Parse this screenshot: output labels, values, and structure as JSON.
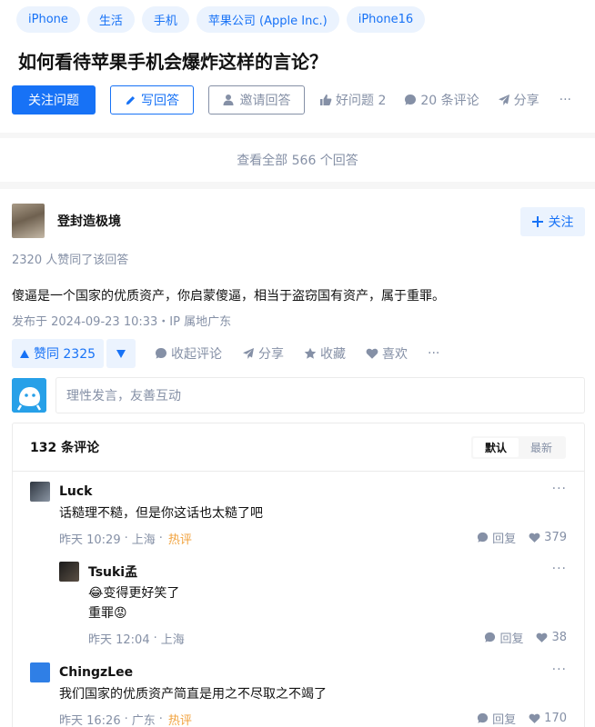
{
  "question": {
    "topics": [
      "iPhone",
      "生活",
      "手机",
      "苹果公司 (Apple Inc.)",
      "iPhone16"
    ],
    "title": "如何看待苹果手机会爆炸这样的言论？",
    "follow_label": "关注问题",
    "write_answer_label": "写回答",
    "invite_label": "邀请回答",
    "good_question_label": "好问题 2",
    "comments_label": "20 条评论",
    "share_label": "分享",
    "more_label": "···"
  },
  "view_all_label": "查看全部 566 个回答",
  "answer": {
    "author_name": "登封造极境",
    "follow_label": "关注",
    "votes_line": "2320 人赞同了该回答",
    "content": "傻逼是一个国家的优质资产，你启蒙傻逼，相当于盗窃国有资产，属于重罪。",
    "publish_info": "发布于 2024-09-23 10:33・IP 属地广东",
    "upvote_label": "赞同 2325",
    "collapse_comments_label": "收起评论",
    "share_label": "分享",
    "collect_label": "收藏",
    "like_label": "喜欢",
    "more_label": "···"
  },
  "reply_box": {
    "placeholder": "理性发言，友善互动"
  },
  "comments": {
    "count_label": "132 条评论",
    "sort_default": "默认",
    "sort_latest": "最新",
    "reply_label": "回复",
    "items": [
      {
        "name": "Luck",
        "text": "话糙理不糙，但是你这话也太糙了吧",
        "time": "昨天 10:29",
        "location": "上海",
        "hot": "热评",
        "likes": "379"
      },
      {
        "name": "Tsuki孟",
        "text_line1": "变得更好笑了",
        "text_line2": "重罪",
        "emoji1": "😂",
        "emoji2": "😡",
        "time": "昨天 12:04",
        "location": "上海",
        "likes": "38"
      },
      {
        "name": "ChingzLee",
        "text": "我们国家的优质资产简直是用之不尽取之不竭了",
        "time": "昨天 16:26",
        "location": "广东",
        "hot": "热评",
        "likes": "170"
      }
    ]
  },
  "colors": {
    "brand_blue": "#1772f6",
    "light_blue_bg": "#ebf3fe",
    "meta_grey": "#8590a6",
    "hot_orange": "#f1a23d"
  }
}
